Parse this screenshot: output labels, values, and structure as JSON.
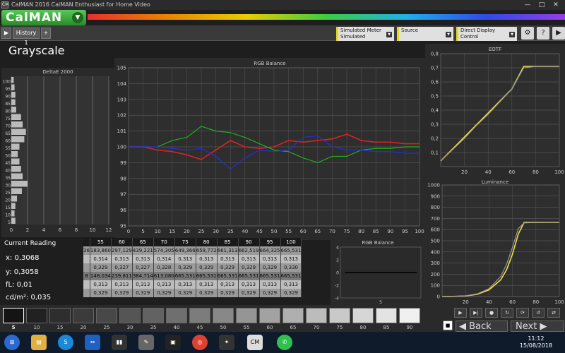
{
  "window": {
    "title": "CalMAN 2016 CalMAN Enthusiast for Home Video",
    "minimize": "—",
    "maximize": "□",
    "close": "✕"
  },
  "logo": {
    "text": "CalMAN"
  },
  "tabs": {
    "back": "▶",
    "history": "History 1",
    "add": "+"
  },
  "toolbar": {
    "meter_line1": "Simulated Meter",
    "meter_line2": "Simulated",
    "source": "Source",
    "display_control": "Direct Display Control",
    "settings": "⚙",
    "help": "?",
    "menu": "▶"
  },
  "page_title": "Grayscale",
  "current_reading": {
    "title": "Current Reading",
    "x": "x: 0,3068",
    "y": "y: 0,3058",
    "fl": "fL: 0,01",
    "cdm2": "cd/m²: 0,035"
  },
  "table": {
    "header": [
      "55",
      "60",
      "65",
      "70",
      "75",
      "80",
      "85",
      "90",
      "95",
      "100"
    ],
    "rows": [
      {
        "lead": "36",
        "cells": [
          "183,860",
          "297,129",
          "439,221",
          "574,305",
          "649,366",
          "658,772",
          "661,313",
          "662,519",
          "664,325",
          "665,531"
        ]
      },
      {
        "lead": "",
        "cells": [
          "0,314",
          "0,313",
          "0,313",
          "0,314",
          "0,313",
          "0,313",
          "0,313",
          "0,313",
          "0,313",
          "0,313"
        ]
      },
      {
        "lead": "",
        "cells": [
          "0,329",
          "0,327",
          "0,327",
          "0,328",
          "0,329",
          "0,329",
          "0,329",
          "0,329",
          "0,329",
          "0,330"
        ]
      },
      {
        "lead": "8",
        "cells": [
          "148,034",
          "239,811",
          "384,714",
          "613,080",
          "665,531",
          "665,531",
          "665,531",
          "665,531",
          "665,531",
          "665,531"
        ]
      },
      {
        "lead": "",
        "cells": [
          "0,313",
          "0,313",
          "0,313",
          "0,313",
          "0,313",
          "0,313",
          "0,313",
          "0,313",
          "0,313",
          "0,313"
        ]
      },
      {
        "lead": "",
        "cells": [
          "0,329",
          "0,329",
          "0,329",
          "0,329",
          "0,329",
          "0,329",
          "0,329",
          "0,329",
          "0,329",
          "0,329"
        ]
      }
    ]
  },
  "patches": [
    "5",
    "10",
    "15",
    "20",
    "25",
    "30",
    "35",
    "40",
    "45",
    "50",
    "55",
    "60",
    "65",
    "70",
    "75",
    "80",
    "85",
    "90"
  ],
  "nav": {
    "back": "Back",
    "next": "Next",
    "stop": "■"
  },
  "taskbar": {
    "time": "11:12",
    "date": "15/08/2018"
  },
  "colors": {
    "red": "#e02020",
    "green": "#20b020",
    "blue": "#2030e0",
    "yellow": "#f0e040",
    "accent": "#e6d81a"
  },
  "chart_data": [
    {
      "type": "bar",
      "title": "DeltaE 2000",
      "orientation": "horizontal",
      "categories": [
        "100",
        "95",
        "90",
        "85",
        "80",
        "75",
        "70",
        "65",
        "60",
        "55",
        "50",
        "45",
        "40",
        "35",
        "30",
        "25",
        "20",
        "15",
        "10",
        "5"
      ],
      "values": [
        0.3,
        0.4,
        0.5,
        0.5,
        0.6,
        1.2,
        1.4,
        1.8,
        1.6,
        1.0,
        0.8,
        1.0,
        1.2,
        1.4,
        2.0,
        1.3,
        0.7,
        0.5,
        0.4,
        0.5
      ],
      "xlim": [
        0,
        12
      ],
      "xticks": [
        "0",
        "2",
        "4",
        "6",
        "8",
        "10",
        "12"
      ]
    },
    {
      "type": "line",
      "title": "RGB Balance",
      "x": [
        0,
        5,
        10,
        15,
        20,
        25,
        30,
        35,
        40,
        45,
        50,
        55,
        60,
        65,
        70,
        75,
        80,
        85,
        90,
        95,
        100
      ],
      "series": [
        {
          "color": "#e02020",
          "values": [
            100,
            100,
            99.8,
            99.7,
            99.5,
            99.2,
            99.8,
            100.4,
            100.0,
            99.9,
            100.0,
            100.4,
            100.3,
            100.4,
            100.5,
            100.8,
            100.4,
            100.3,
            100.3,
            100.2,
            100.2
          ]
        },
        {
          "color": "#20b020",
          "values": [
            100,
            100,
            100.0,
            100.4,
            100.6,
            101.3,
            101.0,
            100.9,
            100.6,
            100.2,
            99.8,
            99.7,
            99.3,
            99.0,
            99.4,
            99.4,
            99.8,
            99.9,
            99.9,
            100.0,
            100.0
          ]
        },
        {
          "color": "#2030e0",
          "values": [
            100,
            100,
            100.0,
            99.9,
            99.8,
            99.9,
            99.4,
            98.6,
            99.3,
            99.8,
            99.7,
            99.8,
            100.6,
            100.7,
            100.0,
            99.8,
            99.8,
            99.7,
            99.7,
            99.6,
            99.6
          ]
        }
      ],
      "ylim": [
        95,
        105
      ],
      "xticks": [
        "0",
        "5",
        "10",
        "15",
        "20",
        "25",
        "30",
        "35",
        "40",
        "45",
        "50",
        "55",
        "60",
        "65",
        "70",
        "75",
        "80",
        "85",
        "90",
        "95",
        "100"
      ],
      "yticks": [
        "95",
        "96",
        "97",
        "98",
        "99",
        "100",
        "101",
        "102",
        "103",
        "104",
        "105"
      ]
    },
    {
      "type": "line",
      "title": "EOTF",
      "x": [
        0,
        10,
        20,
        30,
        40,
        50,
        60,
        70,
        80,
        90,
        100
      ],
      "series": [
        {
          "color": "#f0e040",
          "values": [
            0.04,
            0.125,
            0.21,
            0.295,
            0.38,
            0.465,
            0.55,
            0.71,
            0.71,
            0.71,
            0.71
          ]
        },
        {
          "color": "#999999",
          "values": [
            0.04,
            0.12,
            0.2,
            0.29,
            0.37,
            0.46,
            0.55,
            0.7,
            0.71,
            0.71,
            0.71
          ]
        }
      ],
      "xlim": [
        0,
        100
      ],
      "ylim": [
        0,
        0.8
      ],
      "xticks": [
        "20",
        "40",
        "60",
        "80",
        "100"
      ],
      "yticks": [
        "0,1",
        "0,2",
        "0,3",
        "0,4",
        "0,5",
        "0,6",
        "0,7",
        "0,8"
      ]
    },
    {
      "type": "line",
      "title": "Luminance",
      "x": [
        0,
        10,
        20,
        30,
        40,
        50,
        55,
        60,
        65,
        70,
        75,
        80,
        90,
        100
      ],
      "series": [
        {
          "color": "#f0e040",
          "values": [
            0,
            1,
            5,
            20,
            60,
            150,
            240,
            380,
            560,
            665,
            665,
            665,
            665,
            665
          ]
        },
        {
          "color": "#999999",
          "values": [
            0,
            1,
            6,
            24,
            70,
            180,
            290,
            440,
            610,
            660,
            662,
            664,
            665,
            665
          ]
        }
      ],
      "xlim": [
        0,
        100
      ],
      "ylim": [
        0,
        1000
      ],
      "xticks": [
        "20",
        "40",
        "60",
        "80",
        "100"
      ],
      "yticks": [
        "0",
        "100",
        "200",
        "300",
        "400",
        "500",
        "600",
        "700",
        "800",
        "900",
        "1000"
      ]
    },
    {
      "type": "line",
      "title": "RGB Balance",
      "x": [
        5
      ],
      "series": [],
      "ylim": [
        -4,
        4
      ],
      "xticks": [
        "5"
      ],
      "yticks": [
        "-4",
        "-2",
        "0",
        "2",
        "4"
      ]
    }
  ]
}
